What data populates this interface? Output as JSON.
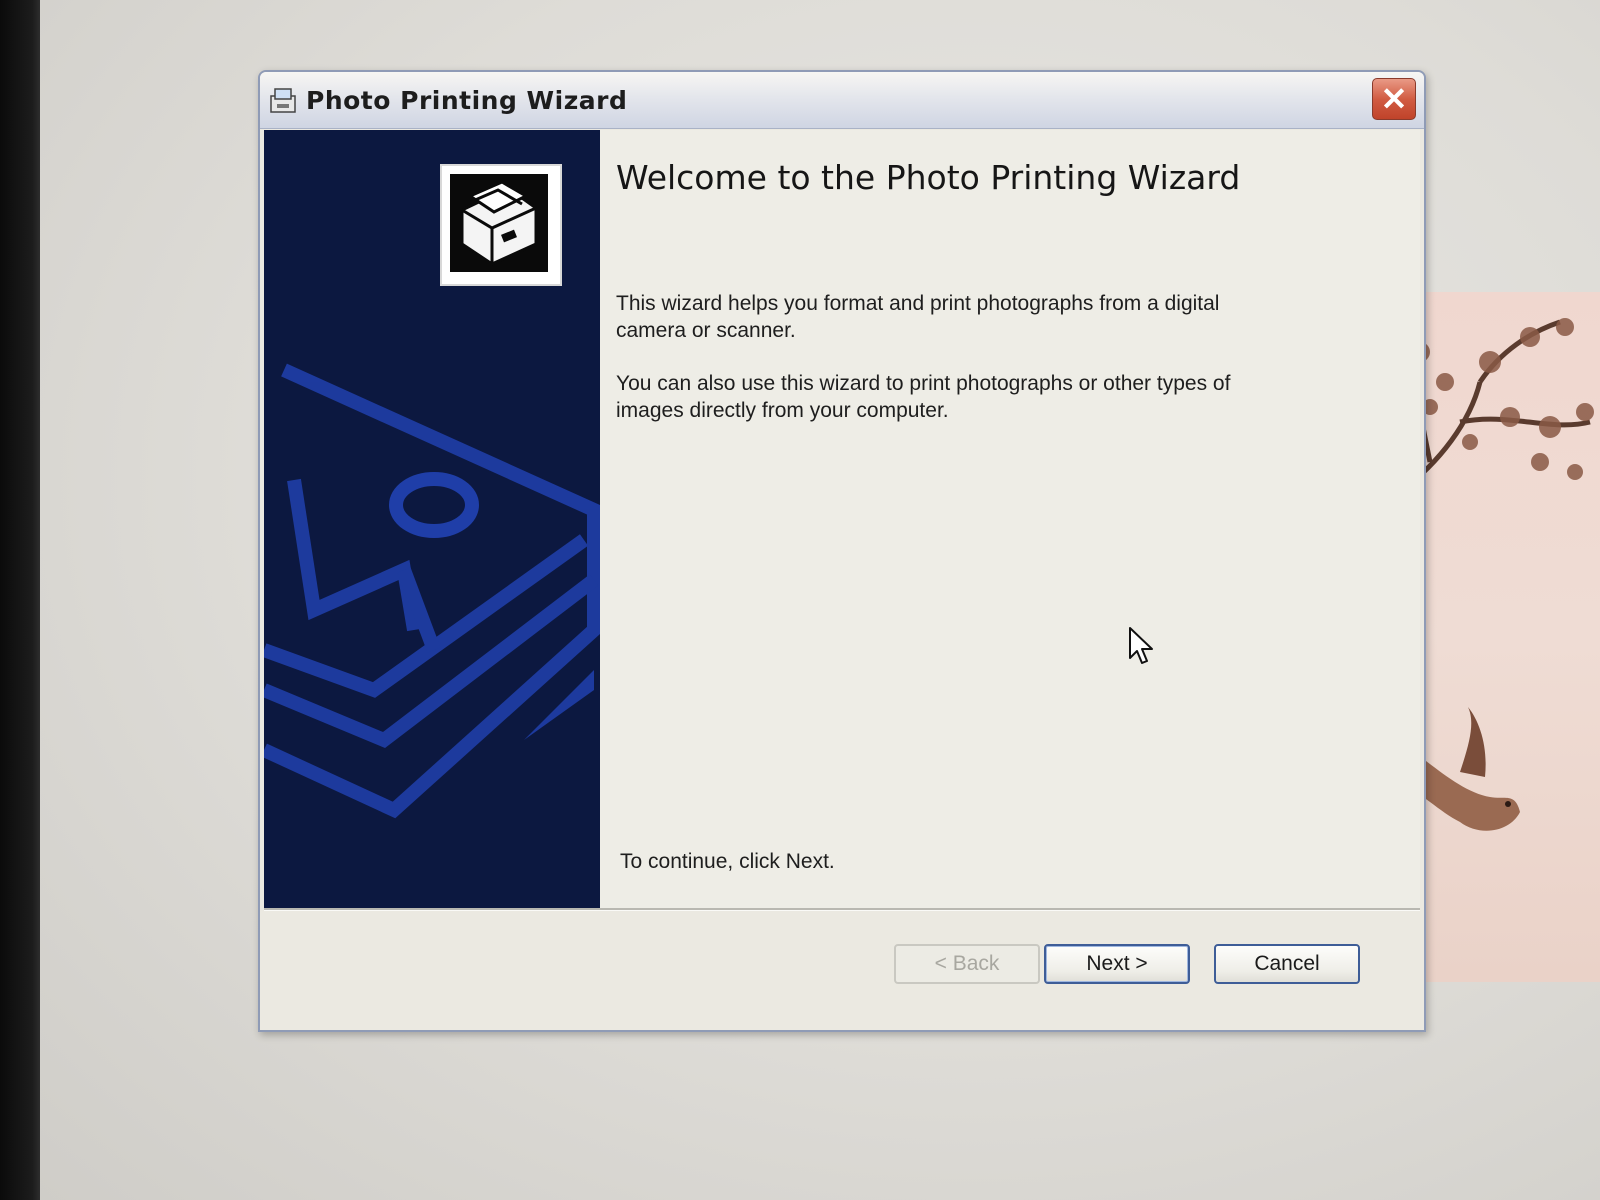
{
  "window": {
    "title": "Photo Printing Wizard",
    "close_label": "✕"
  },
  "content": {
    "heading": "Welcome to the Photo Printing Wizard",
    "paragraph1": "This wizard helps you format and print photographs from a digital camera or scanner.",
    "paragraph2": "You can also use this wizard to print photographs or other types of images directly from your computer.",
    "continue_text": "To continue, click Next."
  },
  "buttons": {
    "back_label": "< Back",
    "next_label": "Next >",
    "cancel_label": "Cancel"
  },
  "colors": {
    "side_panel": "#0c1840",
    "side_panel_accent": "#1f3ea8",
    "close_button": "#d15c43",
    "button_border": "#3e5d97"
  },
  "icons": {
    "title": "photo-printer-icon",
    "wizard": "photo-printer-icon",
    "close": "close-icon",
    "cursor": "mouse-pointer-icon"
  }
}
